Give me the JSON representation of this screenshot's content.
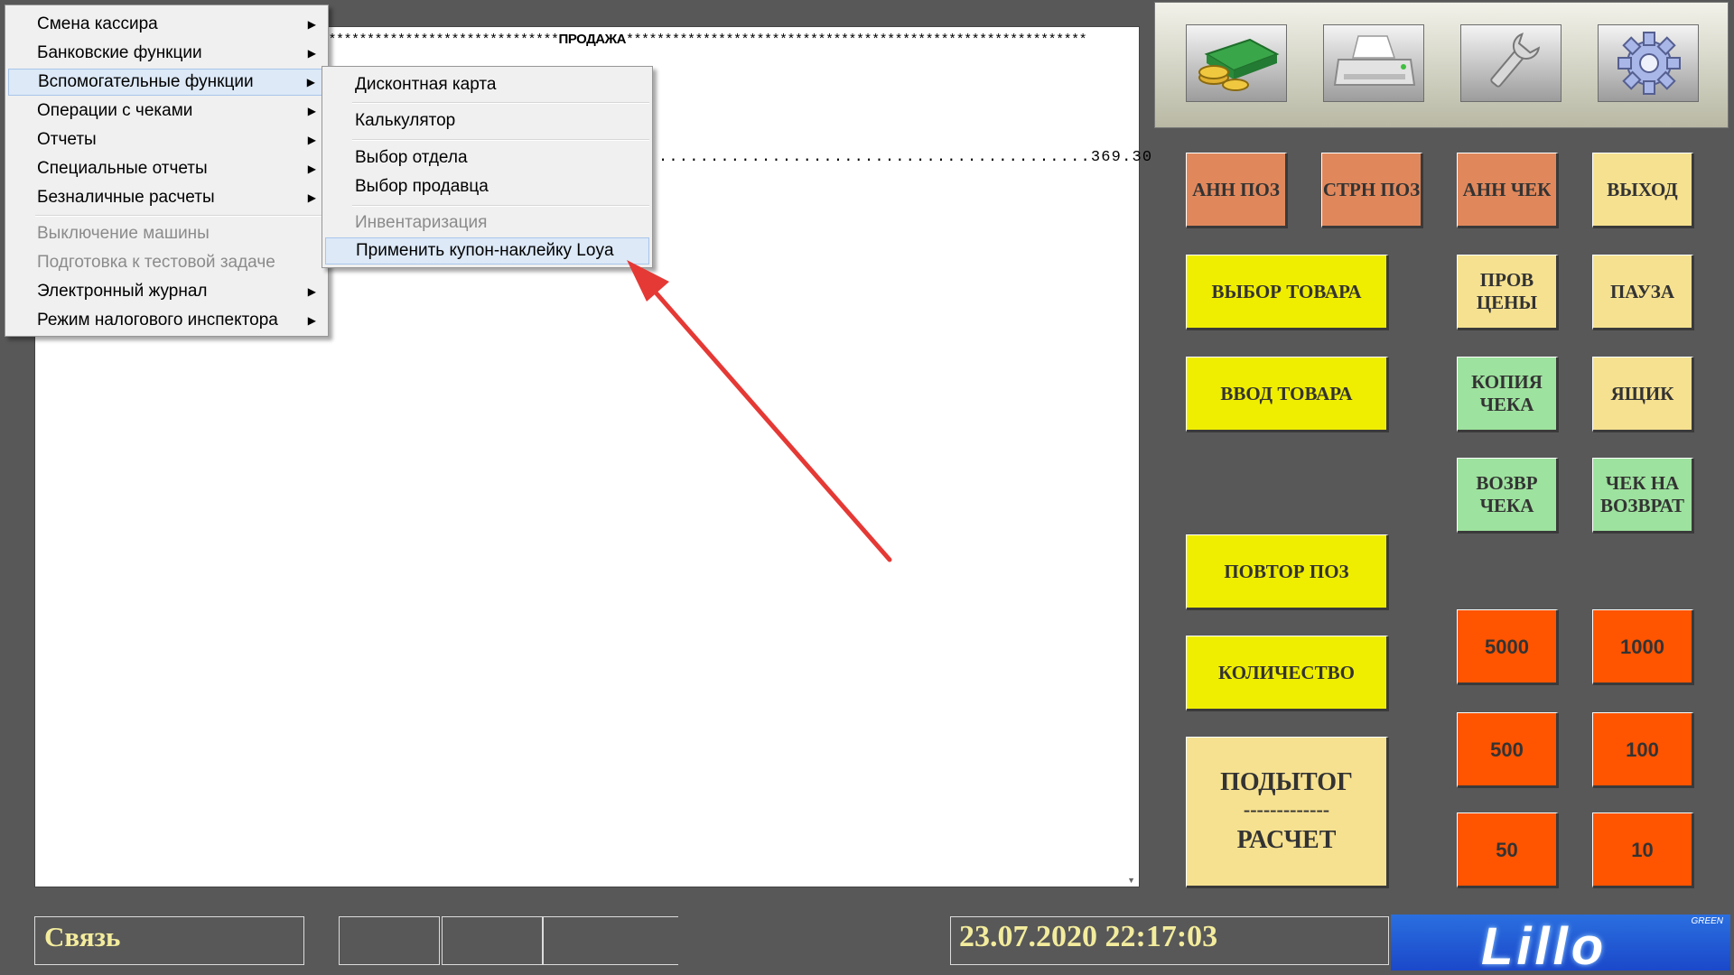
{
  "receipt": {
    "stars_left": "*******************************",
    "title": "ПРОДАЖА",
    "stars_right": "************************************************************",
    "total_dots": "..........................................",
    "total_value": "369.30"
  },
  "main_menu": {
    "items": [
      {
        "label": "Смена кассира",
        "has_submenu": true,
        "disabled": false
      },
      {
        "label": "Банковские функции",
        "has_submenu": true,
        "disabled": false
      },
      {
        "label": "Вспомогательные функции",
        "has_submenu": true,
        "disabled": false,
        "highlighted": true
      },
      {
        "label": "Операции с чеками",
        "has_submenu": true,
        "disabled": false
      },
      {
        "label": "Отчеты",
        "has_submenu": true,
        "disabled": false
      },
      {
        "label": "Специальные отчеты",
        "has_submenu": true,
        "disabled": false
      },
      {
        "label": "Безналичные расчеты",
        "has_submenu": true,
        "disabled": false
      },
      {
        "label": "Выключение машины",
        "has_submenu": false,
        "disabled": true
      },
      {
        "label": "Подготовка к тестовой задаче",
        "has_submenu": false,
        "disabled": true
      },
      {
        "label": "Электронный журнал",
        "has_submenu": true,
        "disabled": false
      },
      {
        "label": "Режим налогового инспектора",
        "has_submenu": true,
        "disabled": false
      }
    ]
  },
  "sub_menu": {
    "items": [
      {
        "label": "Дисконтная карта",
        "disabled": false
      },
      {
        "label": "Калькулятор",
        "disabled": false
      },
      {
        "label": "Выбор отдела",
        "disabled": false
      },
      {
        "label": "Выбор продавца",
        "disabled": false
      },
      {
        "label": "Инвентаризация",
        "disabled": true
      },
      {
        "label": "Применить купон-наклейку Loya",
        "disabled": false,
        "highlighted": true
      }
    ]
  },
  "toolbar": {
    "icons": [
      "money-icon",
      "printer-icon",
      "wrench-icon",
      "gear-icon"
    ]
  },
  "buttons": {
    "ann_pos": "АНН ПОЗ",
    "strn_pos": "СТРН ПОЗ",
    "ann_check": "АНН ЧЕК",
    "exit": "ВЫХОД",
    "select_product": "ВЫБОР ТОВАРА",
    "price_check": "ПРОВ ЦЕНЫ",
    "pause": "ПАУЗА",
    "enter_product": "ВВОД ТОВАРА",
    "copy_check": "КОПИЯ ЧЕКА",
    "drawer": "ЯЩИК",
    "return_check": "ВОЗВР ЧЕКА",
    "check_for_return": "ЧЕК НА ВОЗВРАТ",
    "repeat_pos": "ПОВТОР ПОЗ",
    "quantity": "КОЛИЧЕСТВО",
    "subtotal": "ПОДЫТОГ",
    "subtotal_divider": "-------------",
    "payment": "РАСЧЕТ",
    "cash_5000": "5000",
    "cash_1000": "1000",
    "cash_500": "500",
    "cash_100": "100",
    "cash_50": "50",
    "cash_10": "10"
  },
  "status": {
    "connection": "Связь",
    "datetime": "23.07.2020 22:17:03"
  },
  "logo": {
    "text": "Lillo",
    "tagline": "GREEN"
  },
  "colors": {
    "orange": "#e0885c",
    "light_gold": "#f6e190",
    "yellow": "#f0ee00",
    "green": "#9de29e",
    "red": "#ff5400",
    "arrow": "#e53935"
  }
}
